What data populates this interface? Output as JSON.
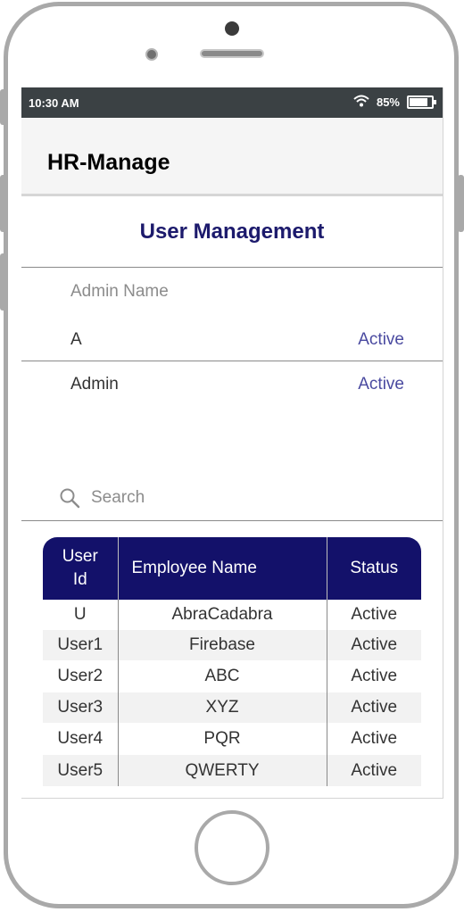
{
  "status_bar": {
    "time": "10:30 AM",
    "battery": "85%",
    "battery_level": 0.85
  },
  "app": {
    "title": "HR-Manage"
  },
  "page": {
    "title": "User Management"
  },
  "admins": {
    "header": "Admin Name",
    "rows": [
      {
        "name": "A",
        "status": "Active"
      },
      {
        "name": "Admin",
        "status": "Active"
      }
    ]
  },
  "search": {
    "placeholder": "Search",
    "value": ""
  },
  "table": {
    "headers": [
      "User\nId",
      "Employee Name",
      "Status"
    ],
    "rows": [
      {
        "id": "U",
        "name": "AbraCadabra",
        "status": "Active"
      },
      {
        "id": "User1",
        "name": "Firebase",
        "status": "Active"
      },
      {
        "id": "User2",
        "name": "ABC",
        "status": "Active"
      },
      {
        "id": "User3",
        "name": "XYZ",
        "status": "Active"
      },
      {
        "id": "User4",
        "name": "PQR",
        "status": "Active"
      },
      {
        "id": "User5",
        "name": "QWERTY",
        "status": "Active"
      }
    ]
  },
  "colors": {
    "accent": "#1c1a6c",
    "header_bg": "#13116a",
    "status_bar": "#3b4144",
    "active_text": "#4a4aa0"
  },
  "icons": {
    "wifi": "wifi-icon",
    "battery": "battery-icon",
    "search": "search-icon"
  }
}
